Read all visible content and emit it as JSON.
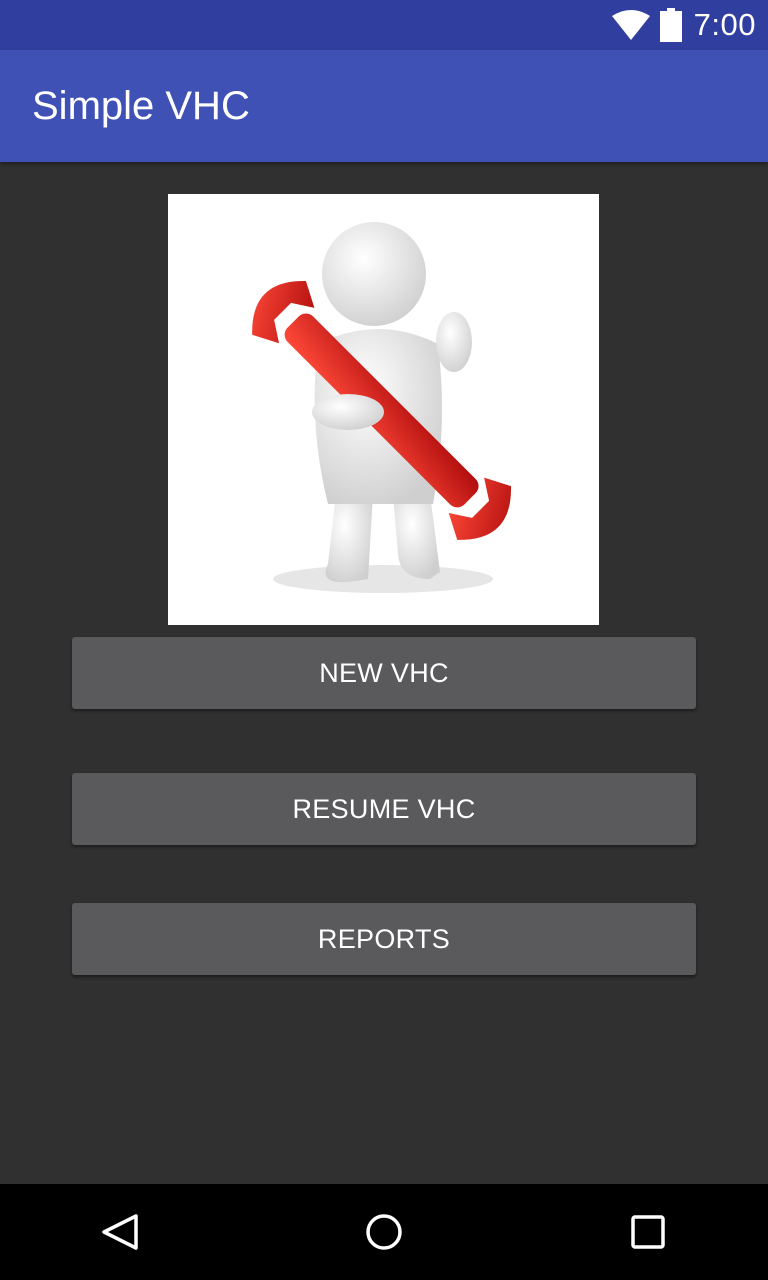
{
  "status_bar": {
    "time": "7:00",
    "wifi_icon": "wifi-icon",
    "battery_icon": "battery-icon"
  },
  "app_bar": {
    "title": "Simple VHC"
  },
  "hero_image": {
    "icon": "mechanic-with-wrench-illustration"
  },
  "buttons": {
    "new_vhc": "NEW VHC",
    "resume_vhc": "RESUME VHC",
    "reports": "REPORTS"
  },
  "nav_bar": {
    "back_icon": "back-triangle-icon",
    "home_icon": "home-circle-icon",
    "recent_icon": "recent-apps-square-icon"
  },
  "colors": {
    "status_bar": "#303F9F",
    "app_bar": "#3F51B5",
    "background": "#303030",
    "button": "#5A5A5C",
    "wrench": "#D0191A"
  }
}
